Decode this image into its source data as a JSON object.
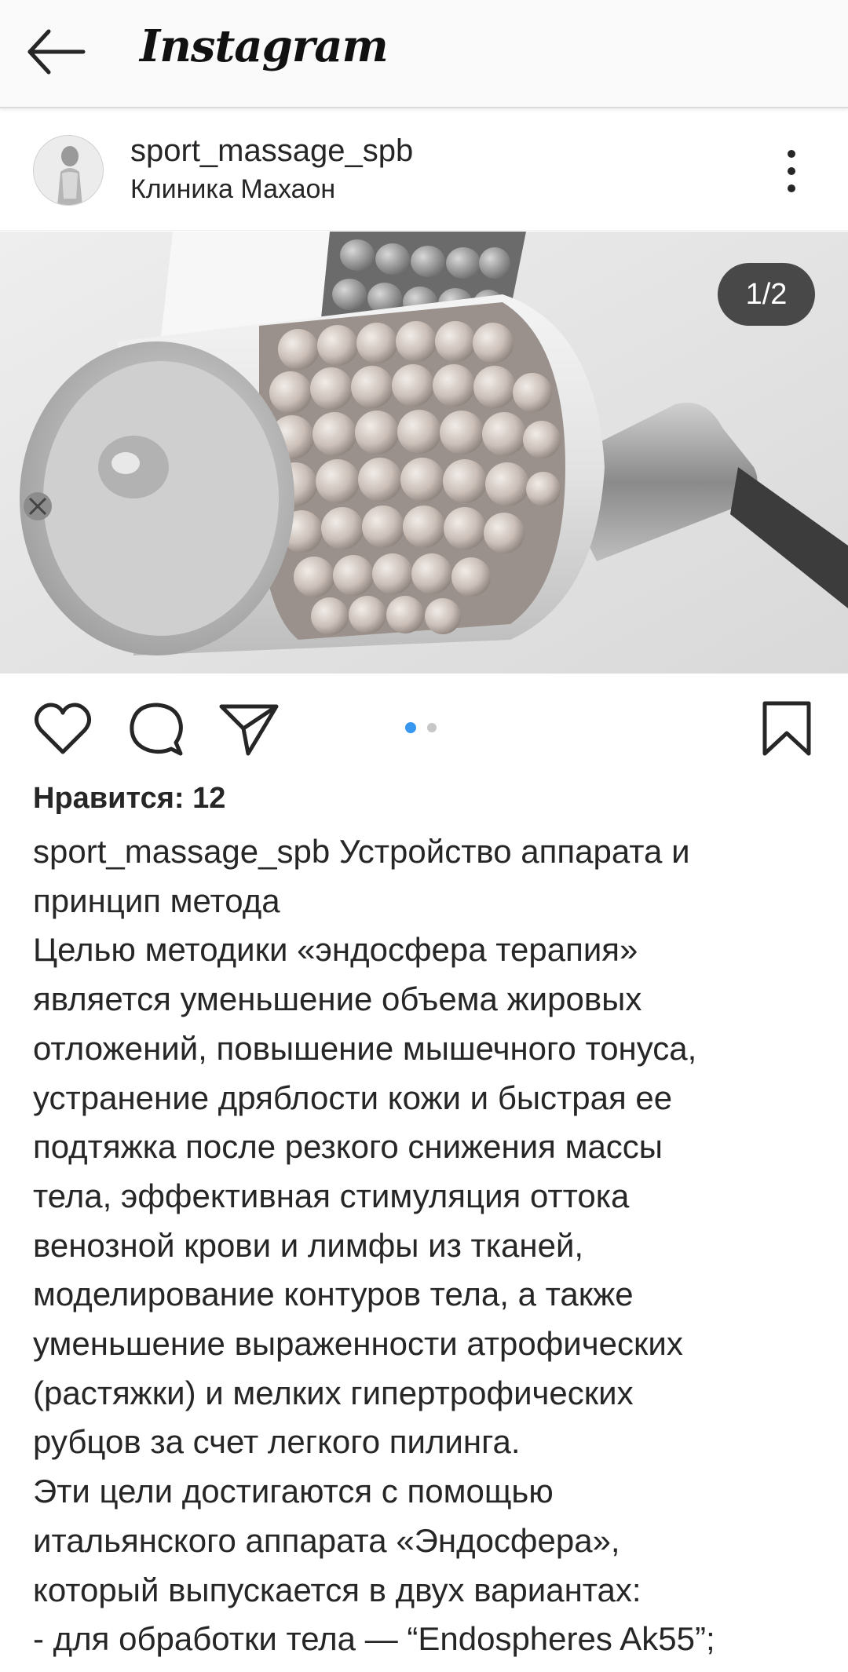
{
  "appbar": {
    "title": "Instagram",
    "back_icon": "arrow-left-icon"
  },
  "post": {
    "username": "sport_massage_spb",
    "location": "Клиника Махаон",
    "more_icon": "more-vertical-icon",
    "media_counter": "1/2",
    "carousel": {
      "total": 2,
      "active": 1,
      "active_color": "#3897f0",
      "inactive_color": "#c7c7c7"
    },
    "actions": {
      "like_icon": "heart-icon",
      "comment_icon": "comment-icon",
      "share_icon": "send-icon",
      "save_icon": "bookmark-icon"
    },
    "likes": "Нравится: 12",
    "caption": {
      "author": "sport_massage_spb",
      "lines": [
        " Устройство аппарата и",
        "принцип метода",
        "Целью методики «эндосфера терапия»",
        "является уменьшение объема жировых",
        "отложений, повышение мышечного тонуса,",
        "устранение дряблости кожи и быстрая ее",
        "подтяжка после резкого снижения массы",
        "тела, эффективная стимуляция оттока",
        "венозной крови и лимфы из тканей,",
        "моделирование контуров тела, а также",
        "уменьшение выраженности атрофических",
        "(растяжки) и мелких гипертрофических",
        "рубцов за счет легкого пилинга.",
        "Эти цели достигаются с помощью",
        "итальянского аппарата «Эндосфера»,",
        "который выпускается в двух вариантах:",
        "- для обработки тела — “Endospheres Ak55”;"
      ]
    }
  }
}
